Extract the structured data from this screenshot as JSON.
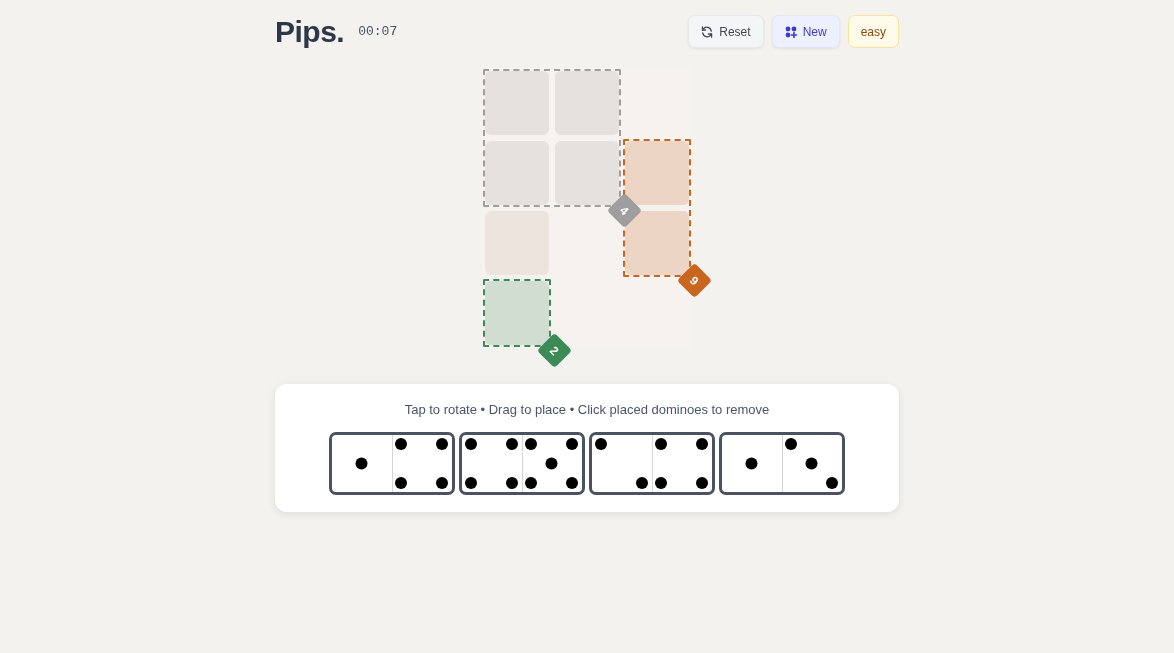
{
  "header": {
    "title": "Pips.",
    "timer": "00:07",
    "buttons": [
      {
        "kind": "reset",
        "label": "Reset"
      },
      {
        "kind": "new",
        "label": "New"
      },
      {
        "kind": "difficulty",
        "label": "easy"
      }
    ]
  },
  "board": {
    "rows": [
      [
        {
          "kind": "region",
          "color": "#9e9e9e"
        },
        {
          "kind": "region",
          "color": "#9e9e9e"
        },
        {
          "kind": "void"
        }
      ],
      [
        {
          "kind": "region",
          "color": "#9e9e9e"
        },
        {
          "kind": "region",
          "color": "#9e9e9e",
          "badge": "4"
        },
        {
          "kind": "region",
          "color": "#c8651f"
        }
      ],
      [
        {
          "kind": "open"
        },
        {
          "kind": "void"
        },
        {
          "kind": "region",
          "color": "#c8651f",
          "badge": "9"
        }
      ],
      [
        {
          "kind": "region",
          "color": "#3c8a56",
          "badge": "2"
        },
        {
          "kind": "void"
        },
        {
          "kind": "void"
        }
      ]
    ]
  },
  "tray": {
    "instructions": "Tap to rotate • Drag to place • Click placed dominoes to remove",
    "dominoes": [
      {
        "halves": [
          {
            "kind": "one"
          },
          {
            "kind": "four"
          }
        ]
      },
      {
        "halves": [
          {
            "kind": "four"
          },
          {
            "kind": "five"
          }
        ]
      },
      {
        "halves": [
          {
            "kind": "two"
          },
          {
            "kind": "four"
          }
        ]
      },
      {
        "halves": [
          {
            "kind": "one"
          },
          {
            "kind": "three"
          }
        ]
      }
    ]
  }
}
